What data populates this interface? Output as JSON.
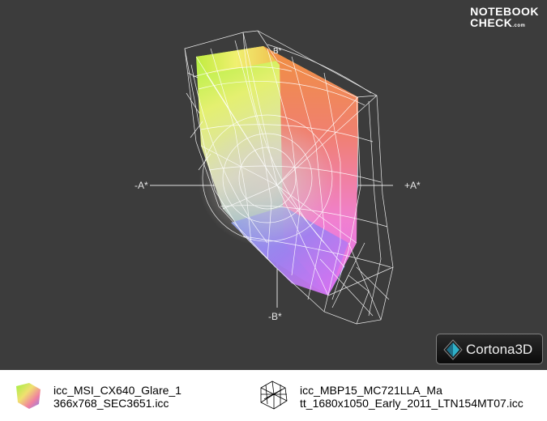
{
  "brand": {
    "line1": "NOTEBOOK",
    "line2": "CHECK",
    "suffix": ".com"
  },
  "axes": {
    "neg_a": "-A*",
    "pos_a": "+A*",
    "neg_b": "-B*",
    "pos_b": "B*"
  },
  "viewer_logo": {
    "text": "Cortona3D"
  },
  "legend": [
    {
      "line1": "icc_MSI_CX640_Glare_1",
      "line2": "366x768_SEC3651.icc",
      "icon": "solid-gamut-icon"
    },
    {
      "line1": "icc_MBP15_MC721LLA_Ma",
      "line2": "tt_1680x1050_Early_2011_LTN154MT07.icc",
      "icon": "wireframe-gamut-icon"
    }
  ],
  "colors": {
    "background": "#3c3c3c",
    "wireframe": "#ffffff"
  }
}
